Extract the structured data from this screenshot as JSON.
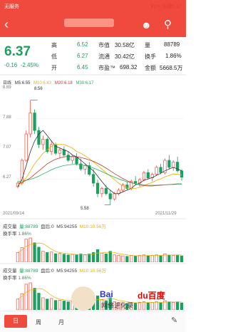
{
  "status_bar": {
    "carrier": "无服务",
    "battery": "91%",
    "time": "傍晚5:17"
  },
  "header": {
    "back_icon": "chevron-left",
    "subtitle": "",
    "robot_icon": "robot",
    "search_icon": "search"
  },
  "quote": {
    "price": "6.37",
    "change": "-0.16",
    "change_pct": "-2.45%",
    "rows": [
      {
        "label1": "高",
        "value1": "6.52",
        "label2": "市值",
        "value2": "30.58亿",
        "label3": "量",
        "value3": "88789"
      },
      {
        "label1": "低",
        "value1": "6.27",
        "label2": "流通",
        "value2": "30.42亿",
        "label3": "换手",
        "value3": "1.86%"
      },
      {
        "label1": "开",
        "value1": "6.45",
        "label2": "市盈™",
        "value2": "698.32",
        "label3": "金额",
        "value3": "5668.5万"
      }
    ]
  },
  "kline_legend": {
    "period": "日线",
    "ma5": "M5:6.55",
    "ma10": "M10:6.43",
    "ma20": "M20:6.18",
    "ma30": "M30:6.17"
  },
  "kline": {
    "y_labels": [
      "8.69",
      "7.88",
      "7.07",
      "6.27"
    ],
    "high_mark": "8.56",
    "low_mark": "5.58",
    "date_start": "2021/09/14",
    "date_end": "2021/11/29"
  },
  "volume_panels": [
    {
      "title": "成交量",
      "vol": "量:88789",
      "pan": "盘后:0",
      "ma5": "M5:94255",
      "ma10": "M10:10.56万",
      "turnover_label": "换手率",
      "turnover": "1.86%"
    },
    {
      "title": "成交量",
      "vol": "量:88789",
      "pan": "盘后:0",
      "ma5": "M5:94255",
      "ma10": "M10:10.56万",
      "turnover_label": "换手率",
      "turnover": "1.86%"
    }
  ],
  "tabs": {
    "day": "日",
    "week": "周",
    "month": "月"
  },
  "watermark": {
    "brand1": "Bai",
    "brand2": "du百度",
    "text": "网络进化录"
  },
  "colors": {
    "red": "#f04a3e",
    "green": "#19a15f",
    "ma5": "#333333",
    "ma10": "#e8b100",
    "ma20": "#c0392b",
    "ma30": "#27ae60"
  },
  "chart_data": {
    "type": "candlestick",
    "xlabel": "",
    "ylabel": "",
    "x_range": [
      "2021/09/14",
      "2021/11/29"
    ],
    "ylim": [
      5.45,
      8.9
    ],
    "ohlc": [
      [
        6.1,
        6.25,
        6.05,
        6.2
      ],
      [
        6.2,
        6.9,
        6.15,
        6.85
      ],
      [
        6.85,
        7.7,
        6.8,
        7.6
      ],
      [
        7.6,
        8.56,
        7.5,
        8.2
      ],
      [
        8.2,
        8.3,
        7.6,
        7.7
      ],
      [
        7.7,
        7.8,
        7.2,
        7.3
      ],
      [
        7.3,
        7.55,
        7.15,
        7.45
      ],
      [
        7.45,
        7.5,
        7.05,
        7.1
      ],
      [
        7.1,
        7.4,
        7.0,
        7.3
      ],
      [
        7.3,
        7.35,
        7.0,
        7.05
      ],
      [
        7.05,
        7.2,
        6.9,
        7.15
      ],
      [
        7.15,
        7.25,
        6.95,
        7.0
      ],
      [
        7.0,
        7.1,
        6.8,
        6.85
      ],
      [
        6.85,
        7.0,
        6.75,
        6.95
      ],
      [
        6.95,
        7.05,
        6.7,
        6.75
      ],
      [
        6.75,
        6.9,
        6.55,
        6.6
      ],
      [
        6.6,
        6.75,
        6.45,
        6.7
      ],
      [
        6.7,
        6.8,
        6.4,
        6.45
      ],
      [
        6.45,
        6.6,
        6.1,
        6.2
      ],
      [
        6.2,
        6.3,
        5.8,
        5.9
      ],
      [
        5.9,
        6.1,
        5.8,
        6.05
      ],
      [
        6.05,
        6.15,
        5.85,
        5.9
      ],
      [
        5.9,
        6.0,
        5.58,
        5.75
      ],
      [
        5.75,
        5.95,
        5.7,
        5.9
      ],
      [
        5.9,
        6.05,
        5.85,
        6.0
      ],
      [
        6.0,
        6.2,
        5.95,
        6.15
      ],
      [
        6.15,
        6.25,
        6.0,
        6.05
      ],
      [
        6.05,
        6.3,
        6.0,
        6.25
      ],
      [
        6.25,
        6.4,
        6.15,
        6.2
      ],
      [
        6.2,
        6.35,
        6.1,
        6.3
      ],
      [
        6.3,
        6.55,
        6.25,
        6.5
      ],
      [
        6.5,
        6.6,
        6.3,
        6.35
      ],
      [
        6.35,
        6.5,
        6.25,
        6.45
      ],
      [
        6.45,
        6.7,
        6.4,
        6.65
      ],
      [
        6.65,
        6.75,
        6.45,
        6.5
      ],
      [
        6.5,
        6.9,
        6.45,
        6.85
      ],
      [
        6.85,
        7.0,
        6.6,
        6.65
      ],
      [
        6.65,
        6.85,
        6.55,
        6.8
      ],
      [
        6.8,
        6.95,
        6.5,
        6.55
      ],
      [
        6.55,
        6.6,
        6.27,
        6.37
      ]
    ],
    "series": [
      {
        "name": "M5",
        "values": [
          6.1,
          6.3,
          6.7,
          7.1,
          7.4,
          7.6,
          7.7,
          7.55,
          7.4,
          7.25,
          7.2,
          7.15,
          7.1,
          7.0,
          6.95,
          6.85,
          6.75,
          6.65,
          6.55,
          6.4,
          6.25,
          6.1,
          6.0,
          5.9,
          5.9,
          5.95,
          6.0,
          6.05,
          6.15,
          6.2,
          6.28,
          6.32,
          6.36,
          6.42,
          6.48,
          6.55,
          6.6,
          6.65,
          6.6,
          6.55
        ]
      },
      {
        "name": "M10",
        "values": [
          6.15,
          6.2,
          6.35,
          6.55,
          6.75,
          6.9,
          7.05,
          7.15,
          7.25,
          7.3,
          7.3,
          7.3,
          7.25,
          7.2,
          7.1,
          7.05,
          6.98,
          6.9,
          6.8,
          6.7,
          6.6,
          6.5,
          6.4,
          6.3,
          6.2,
          6.12,
          6.08,
          6.05,
          6.05,
          6.08,
          6.12,
          6.18,
          6.22,
          6.28,
          6.32,
          6.38,
          6.42,
          6.46,
          6.45,
          6.43
        ]
      },
      {
        "name": "M20",
        "values": [
          6.2,
          6.22,
          6.28,
          6.35,
          6.45,
          6.55,
          6.65,
          6.75,
          6.82,
          6.88,
          6.92,
          6.95,
          6.96,
          6.96,
          6.95,
          6.93,
          6.9,
          6.86,
          6.82,
          6.76,
          6.7,
          6.63,
          6.55,
          6.47,
          6.4,
          6.33,
          6.27,
          6.22,
          6.18,
          6.15,
          6.13,
          6.12,
          6.12,
          6.13,
          6.14,
          6.15,
          6.16,
          6.17,
          6.18,
          6.18
        ]
      },
      {
        "name": "M30",
        "values": [
          6.25,
          6.26,
          6.28,
          6.31,
          6.35,
          6.4,
          6.46,
          6.52,
          6.58,
          6.63,
          6.67,
          6.7,
          6.72,
          6.73,
          6.73,
          6.72,
          6.7,
          6.67,
          6.63,
          6.58,
          6.53,
          6.47,
          6.42,
          6.37,
          6.32,
          6.28,
          6.24,
          6.21,
          6.18,
          6.16,
          6.15,
          6.14,
          6.14,
          6.14,
          6.15,
          6.15,
          6.16,
          6.16,
          6.17,
          6.17
        ]
      }
    ],
    "volume": [
      40,
      60,
      95,
      100,
      80,
      62,
      45,
      40,
      42,
      35,
      36,
      33,
      30,
      32,
      30,
      34,
      30,
      34,
      40,
      52,
      38,
      34,
      45,
      30,
      28,
      26,
      24,
      28,
      26,
      28,
      30,
      26,
      28,
      30,
      26,
      34,
      30,
      28,
      30,
      26
    ]
  }
}
